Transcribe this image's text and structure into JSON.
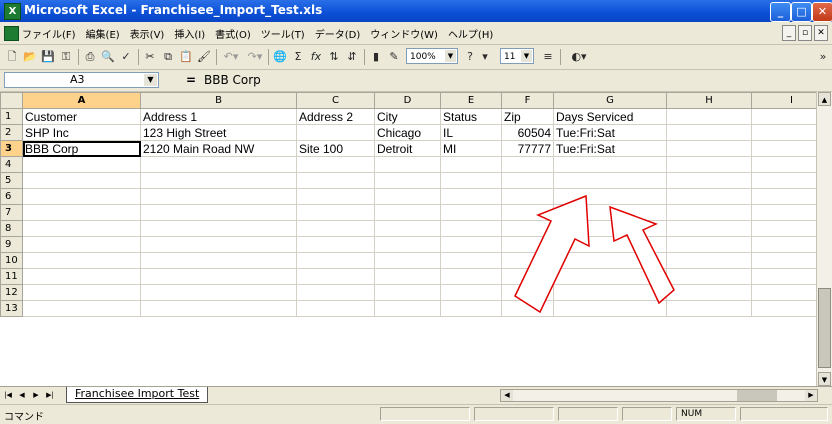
{
  "window": {
    "title": "Microsoft Excel - Franchisee_Import_Test.xls",
    "app_icon": "excel-icon"
  },
  "menu": {
    "items": [
      "ファイル(F)",
      "編集(E)",
      "表示(V)",
      "挿入(I)",
      "書式(O)",
      "ツール(T)",
      "データ(D)",
      "ウィンドウ(W)",
      "ヘルプ(H)"
    ]
  },
  "toolbar": {
    "zoom": "100%",
    "font_size": "11"
  },
  "formula_bar": {
    "name_box": "A3",
    "content": "BBB Corp"
  },
  "columns": [
    "A",
    "B",
    "C",
    "D",
    "E",
    "F",
    "G",
    "H",
    "I"
  ],
  "rows": [
    "1",
    "2",
    "3",
    "4",
    "5",
    "6",
    "7",
    "8",
    "9",
    "10",
    "11",
    "12",
    "13"
  ],
  "cells": [
    [
      "Customer",
      "Address 1",
      "Address 2",
      "City",
      "Status",
      "Zip",
      "Days Serviced"
    ],
    [
      "SHP Inc",
      "123 High Street",
      "",
      "Chicago",
      "IL",
      "60504",
      "Tue:Fri:Sat"
    ],
    [
      "BBB Corp",
      "2120 Main Road NW",
      "Site 100",
      "Detroit",
      "MI",
      "77777",
      "Tue:Fri:Sat"
    ]
  ],
  "sheet_tab": "Franchisee Import Test",
  "status": {
    "text": "コマンド",
    "num": "NUM"
  },
  "accent": {
    "arrow_stroke": "#e00000",
    "title_bar": "#0b4fd6",
    "selected_header": "#ffd28c"
  }
}
